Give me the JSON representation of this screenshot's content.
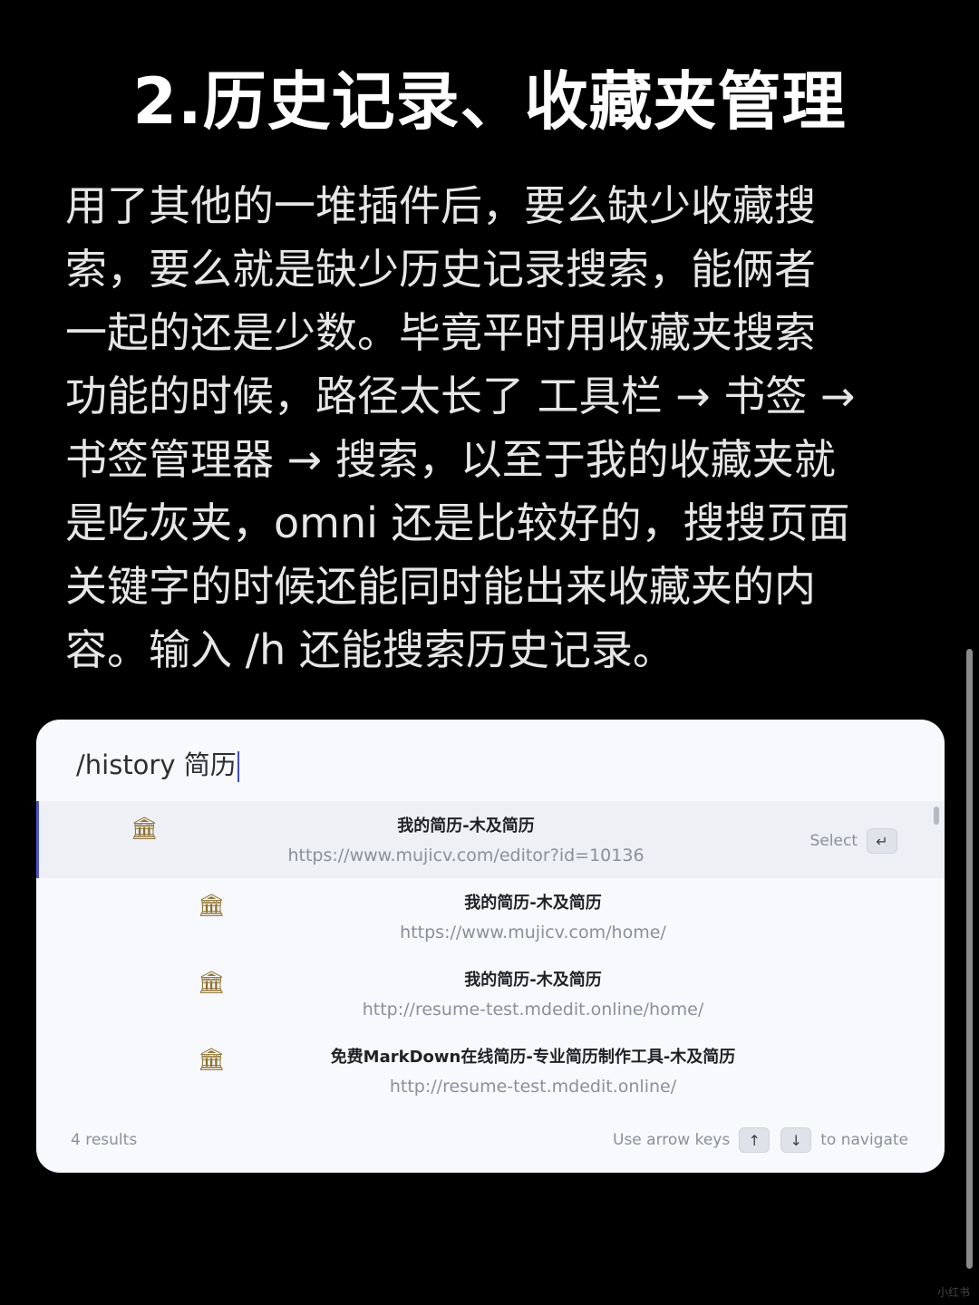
{
  "title": "2.历史记录、收藏夹管理",
  "paragraph": "用了其他的一堆插件后，要么缺少收藏搜\n索，要么就是缺少历史记录搜索，能俩者\n一起的还是少数。毕竟平时用收藏夹搜索\n功能的时候，路径太长了 工具栏 → 书签 →\n书签管理器 → 搜索，以至于我的收藏夹就\n是吃灰夹，omni 还是比较好的，搜搜页面\n关键字的时候还能同时能出来收藏夹的内\n容。输入 /h 还能搜索历史记录。",
  "omni": {
    "input_value": "/history 简历",
    "results": [
      {
        "icon": "museum-icon",
        "glyph": "🏛",
        "title": "我的简历-木及简历",
        "url": "https://www.mujicv.com/editor?id=10136",
        "selected": true
      },
      {
        "icon": "museum-icon",
        "glyph": "🏛",
        "title": "我的简历-木及简历",
        "url": "https://www.mujicv.com/home/",
        "selected": false
      },
      {
        "icon": "museum-icon",
        "glyph": "🏛",
        "title": "我的简历-木及简历",
        "url": "http://resume-test.mdedit.online/home/",
        "selected": false
      },
      {
        "icon": "museum-icon",
        "glyph": "🏛",
        "title": "免费MarkDown在线简历-专业简历制作工具-木及简历",
        "url": "http://resume-test.mdedit.online/",
        "selected": false
      }
    ],
    "select_label": "Select",
    "enter_key": "↵",
    "results_count": "4 results",
    "nav_prefix": "Use arrow keys",
    "up_key": "↑",
    "down_key": "↓",
    "nav_suffix": "to navigate"
  },
  "watermark": "小红书"
}
